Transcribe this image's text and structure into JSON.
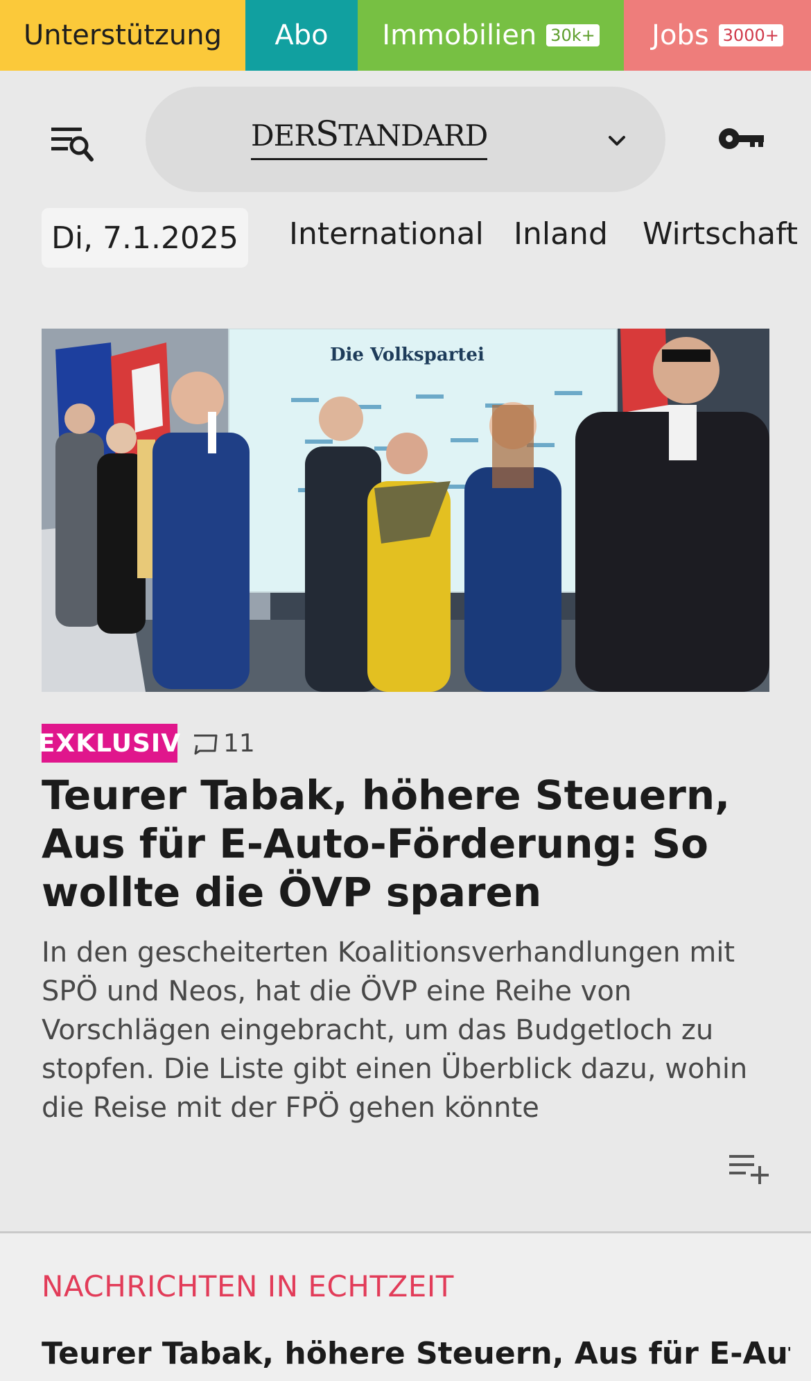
{
  "topbar": {
    "support": "Unterstützung",
    "abo": "Abo",
    "immobilien": "Immobilien",
    "immobilien_badge": "30k+",
    "jobs": "Jobs",
    "jobs_badge": "3000+"
  },
  "header": {
    "logo_der": "DER",
    "logo_s": "S",
    "logo_tandard": "TANDARD"
  },
  "nav": {
    "date": "Di, 7.1.2025",
    "items": [
      "International",
      "Inland",
      "Wirtschaft"
    ]
  },
  "lead_article": {
    "image_text": "Die Volkspartei",
    "tag": "EXKLUSIV",
    "comment_count": "11",
    "headline": "Teurer Tabak, höhere Steuern, Aus für E-Auto-Förderung: So wollte die ÖVP sparen",
    "teaser": "In den gescheiterten Koalitionsverhandlungen mit SPÖ und Neos, hat die ÖVP eine Reihe von Vorschlägen eingebracht, um das Budgetloch zu stopfen. Die Liste gibt einen Überblick dazu, wohin die Reise mit der FPÖ gehen könnte"
  },
  "live_section": {
    "label": "NACHRICHTEN IN ECHTZEIT",
    "first_headline": "Teurer Tabak, höhere Steuern, Aus für E-Auto-"
  },
  "icons": {
    "menu": "menu-search-icon",
    "chevron": "chevron-down-icon",
    "login": "key-icon",
    "comments": "comment-icon",
    "playlist": "add-to-playlist-icon"
  },
  "colors": {
    "support": "#fbc93a",
    "abo": "#11a0a0",
    "immobilien": "#77c043",
    "jobs": "#ee7d7b",
    "exklusiv": "#e0168c",
    "live_label": "#e23c59"
  }
}
